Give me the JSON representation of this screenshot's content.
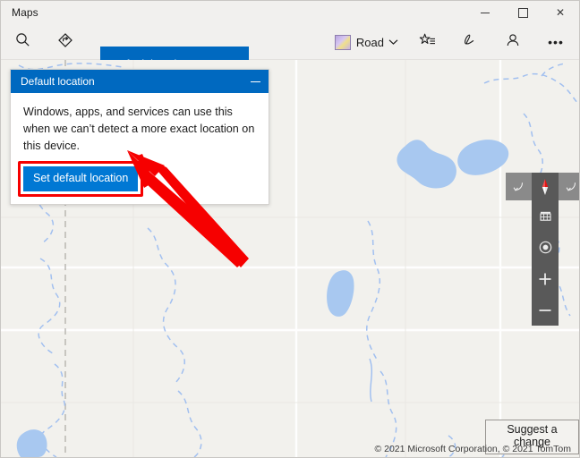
{
  "window": {
    "app_title": "Maps",
    "controls": {
      "minimize": "–",
      "maximize": "□",
      "close": "✕"
    },
    "control_names": {
      "minimize": "minimize",
      "maximize": "maximize",
      "close": "close"
    }
  },
  "commandbar": {
    "search_icon": "search-icon",
    "directions_icon": "directions-icon",
    "tab": {
      "label": "Default location",
      "close": "✕"
    },
    "map_style": {
      "label": "Road",
      "chevron": "⌄",
      "thumb_icon": "map-style-thumbnail"
    },
    "favorites_icon": "favorites-star-icon",
    "ink_icon": "ink-pen-icon",
    "account_icon": "account-person-icon",
    "more_icon": "•••"
  },
  "panel": {
    "title": "Default location",
    "minimize_glyph": "–",
    "body_text": "Windows, apps, and services can use this when we can’t detect a more exact location on this device.",
    "button_label": "Set default location",
    "highlight_color": "#f60000"
  },
  "map_controls": {
    "rotate_left": "↶",
    "rotate_right": "↷",
    "compass": "compass-needle",
    "tilt_3d": "3d-city-view-icon",
    "my_location": "my-location-icon",
    "zoom_in": "+",
    "zoom_out": "–"
  },
  "map_overlays": {
    "suggest_change": "Suggest a change",
    "copyright": "© 2021 Microsoft Corporation, © 2021 TomTom"
  },
  "colors": {
    "accent_blue": "#0078d4",
    "tab_blue": "#0069c0",
    "map_background": "#f2f1ed",
    "water": "#a8c8f0",
    "control_strip": "#595959",
    "annotation_red": "#f60000"
  }
}
